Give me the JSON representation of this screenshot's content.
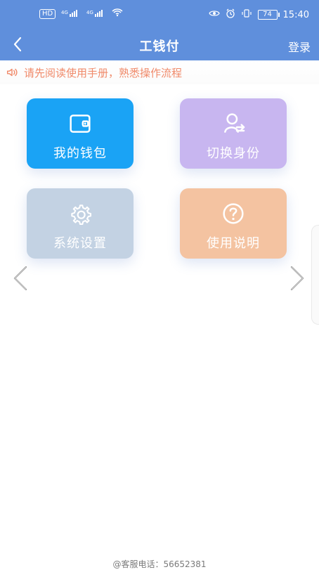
{
  "status_bar": {
    "left_items": [
      "HD",
      "4G",
      "4G"
    ],
    "battery": "74",
    "time": "15:40"
  },
  "header": {
    "title": "工钱付",
    "back_icon": "chevron-left-icon",
    "login_label": "登录"
  },
  "notice": {
    "text": "请先阅读使用手册，熟悉操作流程",
    "icon": "speaker-icon",
    "color": "#f08a6a"
  },
  "tiles": [
    {
      "label": "我的钱包",
      "icon": "wallet-icon",
      "color": "#1aa3f5"
    },
    {
      "label": "切换身份",
      "icon": "switch-user-icon",
      "color": "#c8b6f0"
    },
    {
      "label": "系统设置",
      "icon": "gear-icon",
      "color": "#c3d2e3"
    },
    {
      "label": "使用说明",
      "icon": "help-icon",
      "color": "#f4c3a1"
    }
  ],
  "pager": {
    "left_icon": "chevron-left-icon",
    "right_icon": "chevron-right-icon"
  },
  "footer": {
    "service_phone": "@客服电话：56652381"
  }
}
